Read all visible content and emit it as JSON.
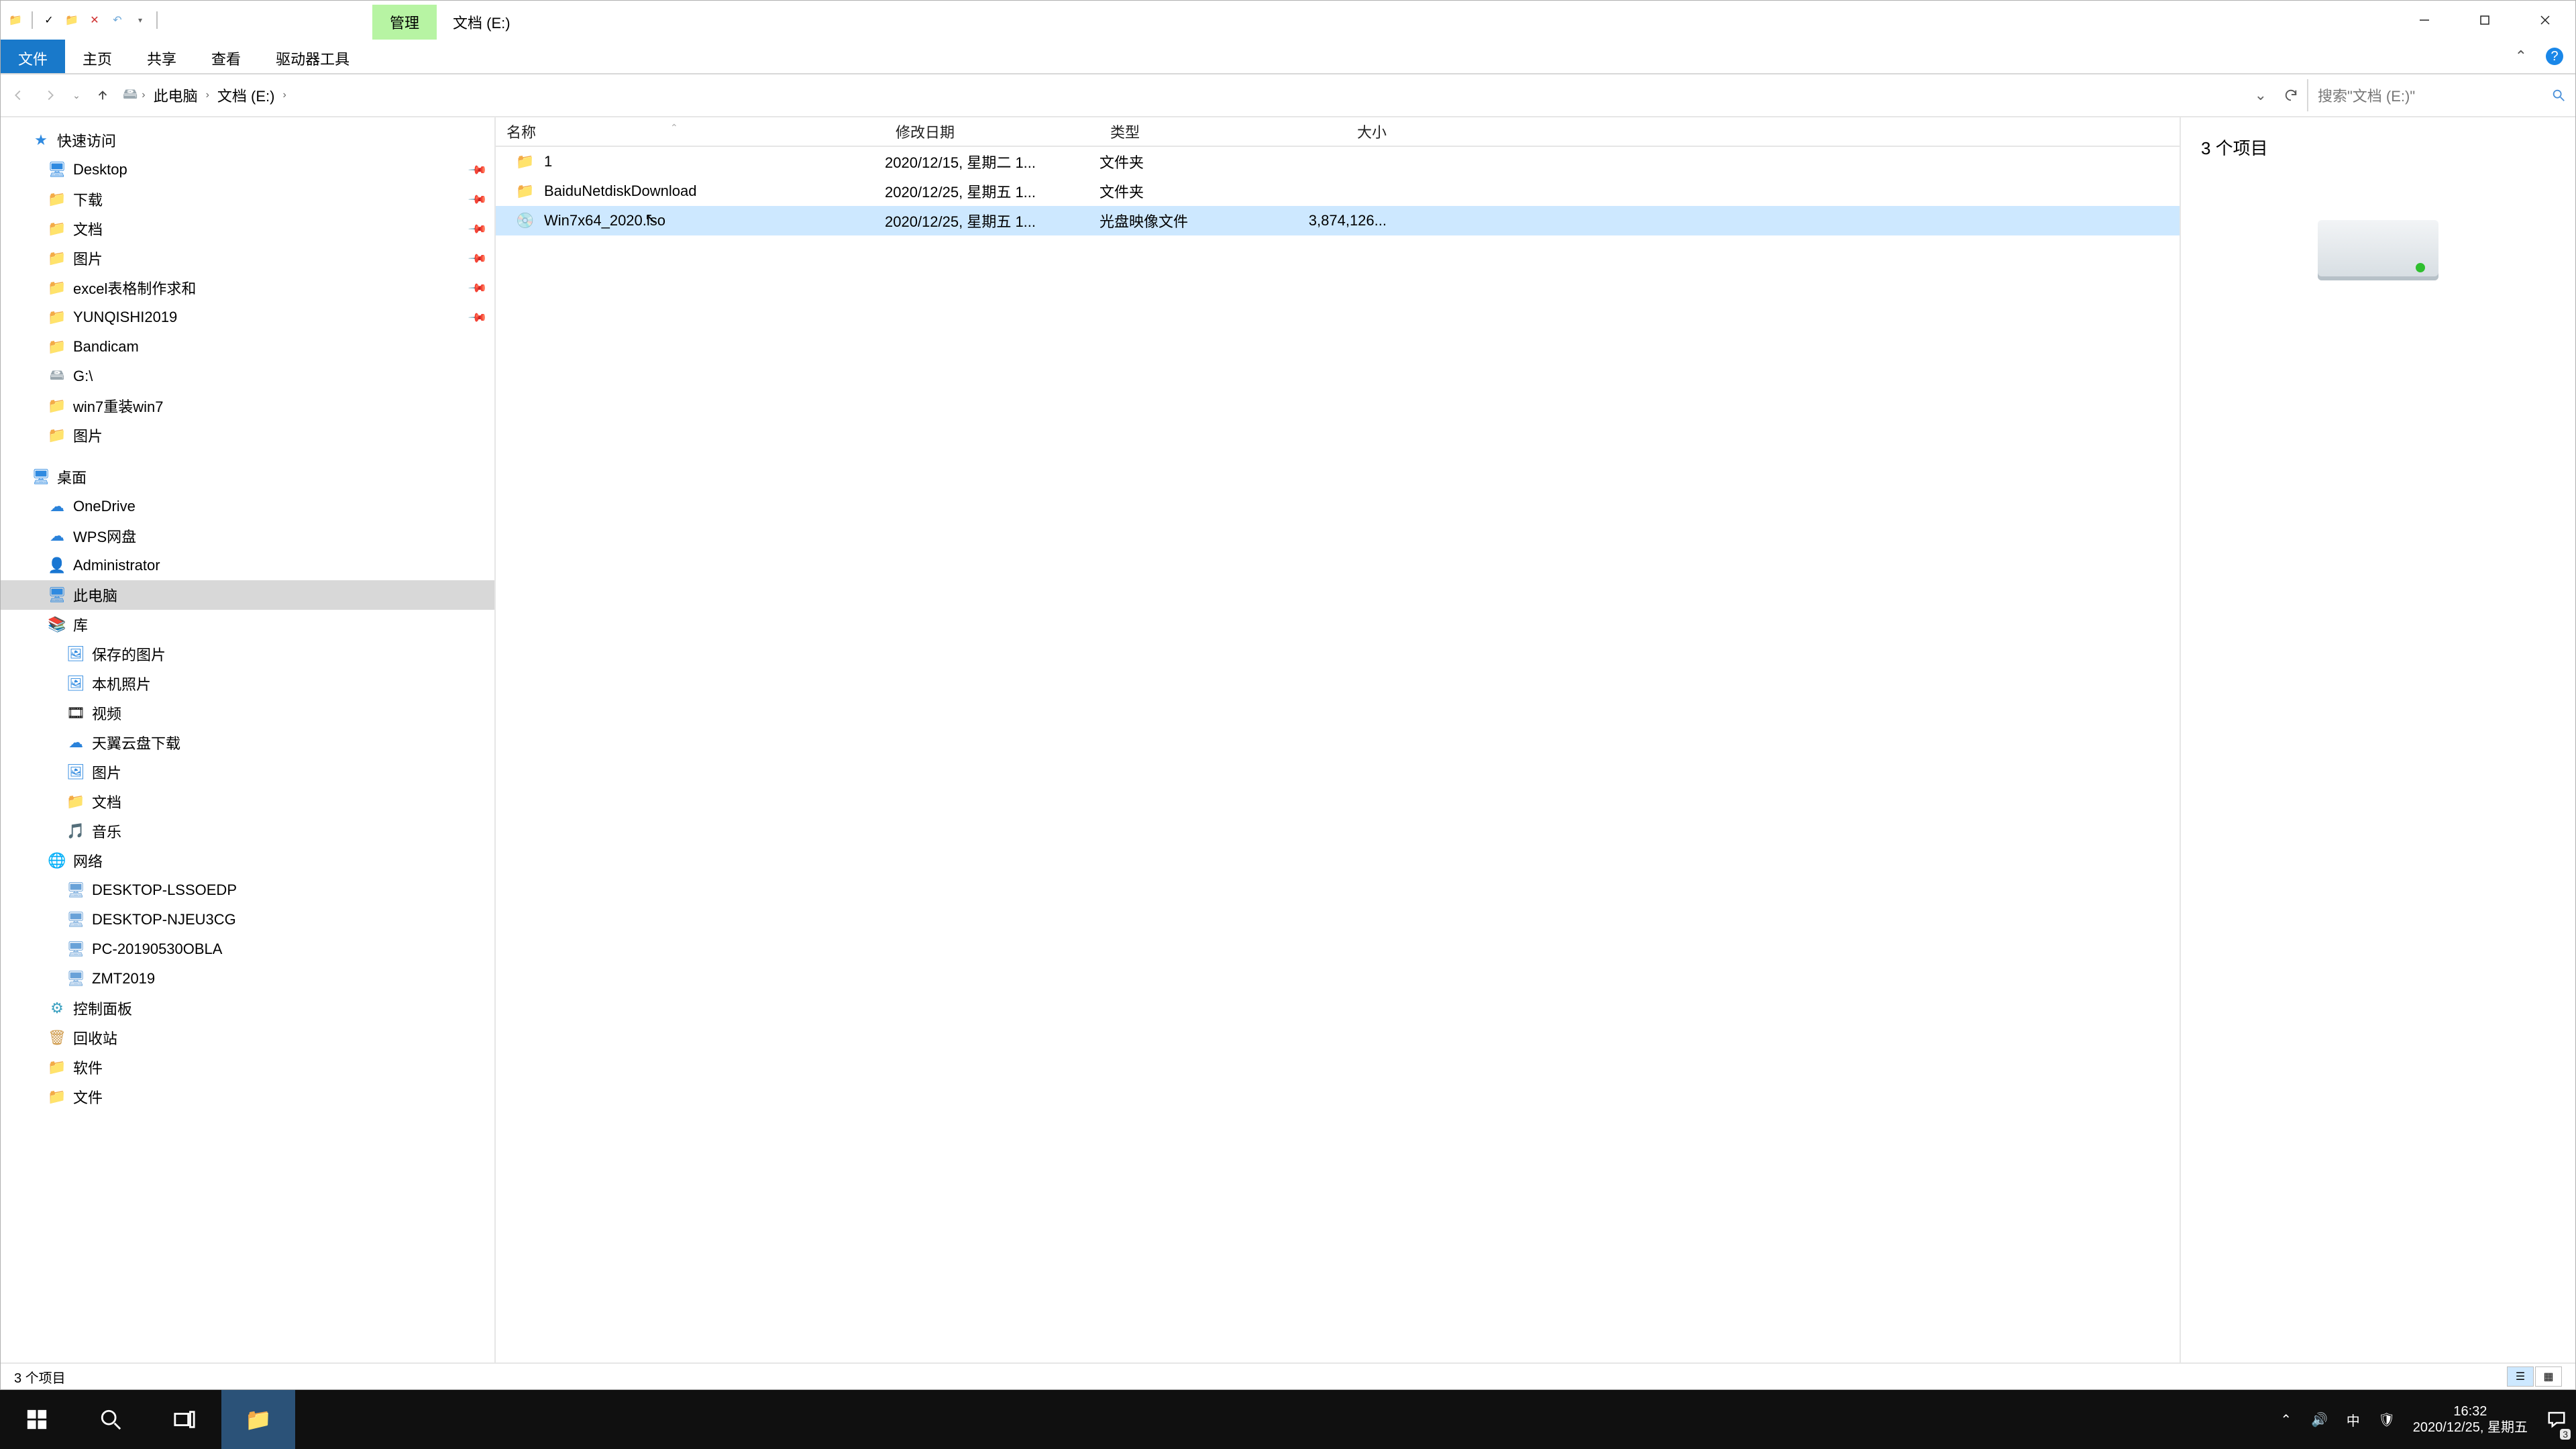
{
  "titlebar": {
    "manage_tab": "管理",
    "title": "文档 (E:)"
  },
  "ribbon": {
    "file": "文件",
    "home": "主页",
    "share": "共享",
    "view": "查看",
    "drive_tools": "驱动器工具"
  },
  "breadcrumb": {
    "seg1": "此电脑",
    "seg2": "文档 (E:)"
  },
  "search": {
    "placeholder": "搜索\"文档 (E:)\""
  },
  "nav": {
    "quick": "快速访问",
    "desktop": "Desktop",
    "downloads": "下载",
    "documents": "文档",
    "pictures": "图片",
    "excel": "excel表格制作求和",
    "yunqishi": "YUNQISHI2019",
    "bandicam": "Bandicam",
    "g": "G:\\",
    "win7r": "win7重装win7",
    "pictures2": "图片",
    "desktop2": "桌面",
    "onedrive": "OneDrive",
    "wps": "WPS网盘",
    "admin": "Administrator",
    "thispc": "此电脑",
    "lib": "库",
    "savedpics": "保存的图片",
    "localpics": "本机照片",
    "video": "视频",
    "tianyi": "天翼云盘下载",
    "pic3": "图片",
    "doc2": "文档",
    "music": "音乐",
    "network": "网络",
    "pc1": "DESKTOP-LSSOEDP",
    "pc2": "DESKTOP-NJEU3CG",
    "pc3": "PC-20190530OBLA",
    "pc4": "ZMT2019",
    "ctrlpanel": "控制面板",
    "recycle": "回收站",
    "soft": "软件",
    "files": "文件"
  },
  "columns": {
    "name": "名称",
    "date": "修改日期",
    "type": "类型",
    "size": "大小"
  },
  "rows": [
    {
      "name": "1",
      "date": "2020/12/15, 星期二 1...",
      "type": "文件夹",
      "size": "",
      "icon": "folder"
    },
    {
      "name": "BaiduNetdiskDownload",
      "date": "2020/12/25, 星期五 1...",
      "type": "文件夹",
      "size": "",
      "icon": "folder"
    },
    {
      "name": "Win7x64_2020.iso",
      "date": "2020/12/25, 星期五 1...",
      "type": "光盘映像文件",
      "size": "3,874,126...",
      "icon": "iso",
      "selected": true
    }
  ],
  "preview": {
    "count": "3 个项目"
  },
  "status": {
    "count": "3 个项目"
  },
  "tray": {
    "ime": "中",
    "time": "16:32",
    "date": "2020/12/25, 星期五",
    "notif_count": "3"
  }
}
